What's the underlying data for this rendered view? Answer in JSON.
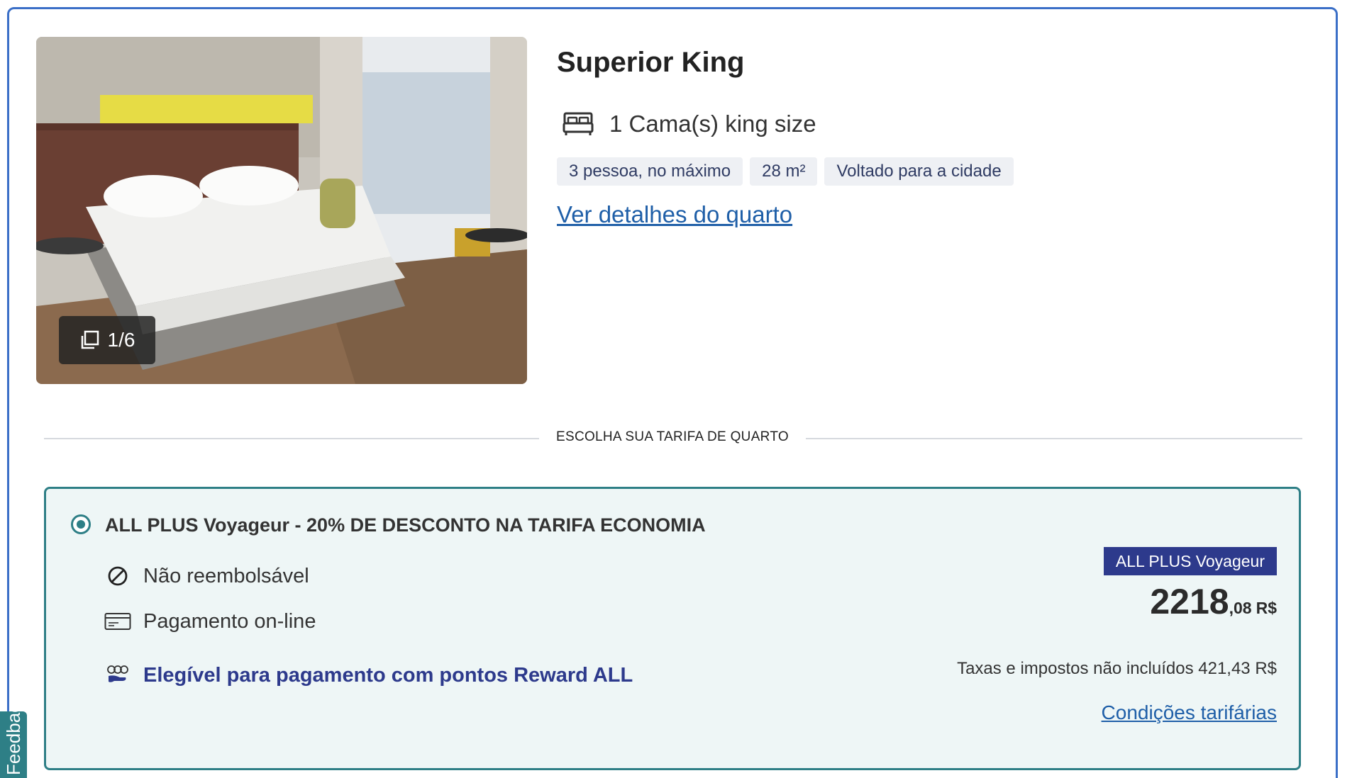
{
  "room": {
    "name": "Superior King",
    "bed": "1 Cama(s) king size",
    "features": [
      "3 pessoa, no máximo",
      "28 m²",
      "Voltado para a cidade"
    ],
    "details_link": "Ver detalhes do quarto",
    "photo_counter": "1/6"
  },
  "rates_section": {
    "heading": "ESCOLHA SUA TARIFA DE QUARTO"
  },
  "rate": {
    "title": "ALL PLUS Voyageur - 20% DE DESCONTO NA TARIFA ECONOMIA",
    "selected": true,
    "refund_policy": "Não reembolsável",
    "payment": "Pagamento on-line",
    "reward": "Elegível para pagamento com pontos Reward ALL",
    "badge": "ALL PLUS Voyageur",
    "price_integer": "2218",
    "price_decimal": ",08",
    "currency": "R$",
    "taxes": "Taxas e impostos não incluídos 421,43 R$",
    "conditions_link": "Condições tarifárias"
  },
  "feedback_tab": "Feedback",
  "colors": {
    "card_border": "#3b6fc7",
    "rate_border": "#2e7f86",
    "rate_background": "#eef6f6",
    "badge_background": "#2d3a8c",
    "link": "#1f5fa8"
  },
  "icons": {
    "gallery": "gallery-icon",
    "bed": "bed-icon",
    "refund": "no-refund-icon",
    "payment": "credit-card-icon",
    "reward": "reward-points-icon"
  }
}
